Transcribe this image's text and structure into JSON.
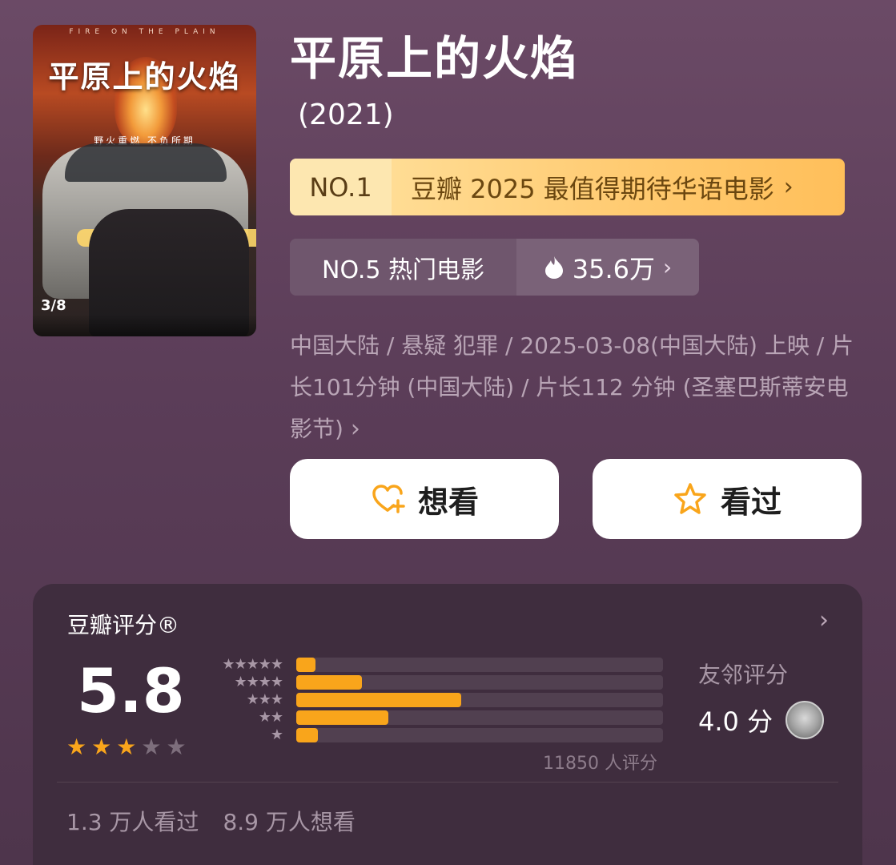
{
  "poster": {
    "title": "平原上的火焰",
    "english": "FIRE ON THE PLAIN",
    "slogan": "野火重燃 不负所期",
    "date": "3/8"
  },
  "movie": {
    "title": "平原上的火焰",
    "year": "(2021)"
  },
  "ranks": {
    "top": {
      "no": "NO.1",
      "label": "豆瓣 2025 最值得期待华语电影"
    },
    "hot": {
      "label": "NO.5 热门电影",
      "heat": "35.6万"
    }
  },
  "meta": {
    "text": "中国大陆 / 悬疑 犯罪 / 2025-03-08(中国大陆) 上映 / 片长101分钟 (中国大陆) / 片长112 分钟 (圣塞巴斯蒂安电影节)"
  },
  "actions": {
    "want_label": "想看",
    "seen_label": "看过"
  },
  "rating": {
    "title": "豆瓣评分®",
    "score": "5.8",
    "stars_filled": 3,
    "stars_total": 5,
    "distribution": [
      {
        "stars": 5,
        "fraction": 0.05
      },
      {
        "stars": 4,
        "fraction": 0.18
      },
      {
        "stars": 3,
        "fraction": 0.45
      },
      {
        "stars": 2,
        "fraction": 0.25
      },
      {
        "stars": 1,
        "fraction": 0.06
      }
    ],
    "count_text": "11850 人评分",
    "friends_label": "友邻评分",
    "friends_score": "4.0 分",
    "watched": "1.3 万人看过",
    "wanted": "8.9 万人想看"
  },
  "colors": {
    "accent": "#f9a51b",
    "rank_gold": "#ffcb72",
    "bg": "#5b3d58",
    "card": "#3f2d3e"
  }
}
